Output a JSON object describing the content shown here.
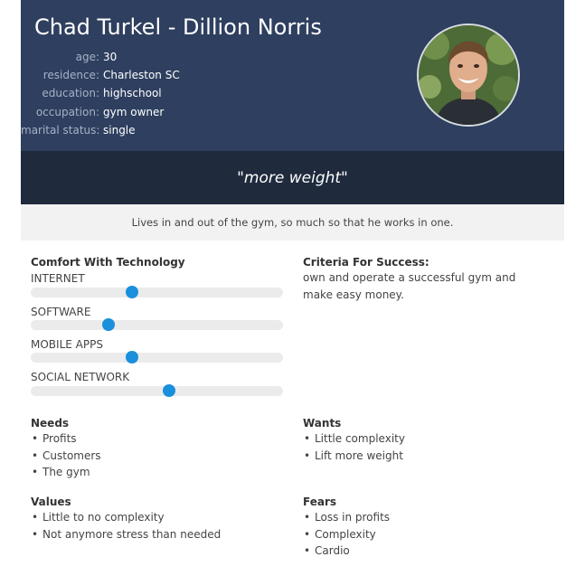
{
  "persona": {
    "name": "Chad Turkel - Dillion Norris",
    "info": [
      {
        "label": "age:",
        "value": "30"
      },
      {
        "label": "residence:",
        "value": "Charleston SC"
      },
      {
        "label": "education:",
        "value": "highschool"
      },
      {
        "label": "occupation:",
        "value": "gym owner"
      },
      {
        "label": "marital status:",
        "value": "single"
      }
    ],
    "quote": "\"more weight\"",
    "bio": "Lives in and out of the gym, so much so that he works in one."
  },
  "technology": {
    "title": "Comfort With Technology",
    "sliders": [
      {
        "label": "INTERNET",
        "level": 0.4
      },
      {
        "label": "SOFTWARE",
        "level": 0.31
      },
      {
        "label": "MOBILE APPS",
        "level": 0.4
      },
      {
        "label": "SOCIAL NETWORK",
        "level": 0.55
      }
    ]
  },
  "criteria": {
    "title": "Criteria For Success:",
    "text": "own and operate a successful gym and make easy money."
  },
  "needs": {
    "title": "Needs",
    "items": [
      "Profits",
      "Customers",
      "The gym"
    ]
  },
  "wants": {
    "title": "Wants",
    "items": [
      "Little complexity",
      "Lift more weight"
    ]
  },
  "values": {
    "title": "Values",
    "items": [
      "Little to no complexity",
      "Not anymore stress than needed"
    ]
  },
  "fears": {
    "title": "Fears",
    "items": [
      "Loss in profits",
      "Complexity",
      "Cardio"
    ]
  },
  "colors": {
    "header": "#2e3f5f",
    "quote_band": "#1f2a3d",
    "slider_thumb": "#1a8fdb",
    "bio_band": "#f2f2f2"
  }
}
